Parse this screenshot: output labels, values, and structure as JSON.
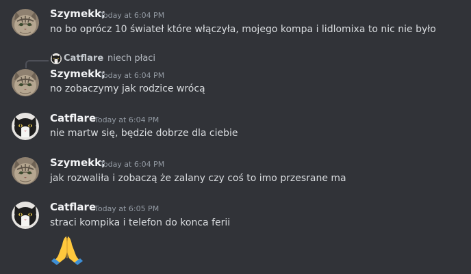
{
  "messages": [
    {
      "author": "Szymekk;",
      "avatar_icon": "tabby-cat-avatar-icon",
      "timestamp": "Today at 6:04 PM",
      "text": "no bo oprócz 10 świateł które włączyła, mojego kompa i lidlomixa to nic nie było"
    },
    {
      "reply_to": {
        "author": "Catflare",
        "avatar_icon": "black-white-cat-avatar-icon",
        "text": "niech płaci"
      },
      "author": "Szymekk;",
      "avatar_icon": "tabby-cat-avatar-icon",
      "timestamp": "Today at 6:04 PM",
      "text": "no zobaczymy jak rodzice wrócą"
    },
    {
      "author": "Catflare",
      "avatar_icon": "black-white-cat-avatar-icon",
      "timestamp": "Today at 6:04 PM",
      "text": "nie martw się, będzie dobrze dla ciebie"
    },
    {
      "author": "Szymekk;",
      "avatar_icon": "tabby-cat-avatar-icon",
      "timestamp": "Today at 6:04 PM",
      "text": "jak rozwaliła i zobaczą że zalany czy coś to imo przesrane ma"
    },
    {
      "author": "Catflare",
      "avatar_icon": "black-white-cat-avatar-icon",
      "timestamp": "Today at 6:05 PM",
      "text": "straci kompika i telefon do konca ferii",
      "emoji": "🙏",
      "emoji_icon": "folded-hands-emoji-icon"
    }
  ],
  "colors": {
    "background": "#313338",
    "username": "#f2f3f5",
    "text": "#dbdee1",
    "timestamp": "#949ba4",
    "reply_spine": "#4e5058"
  }
}
